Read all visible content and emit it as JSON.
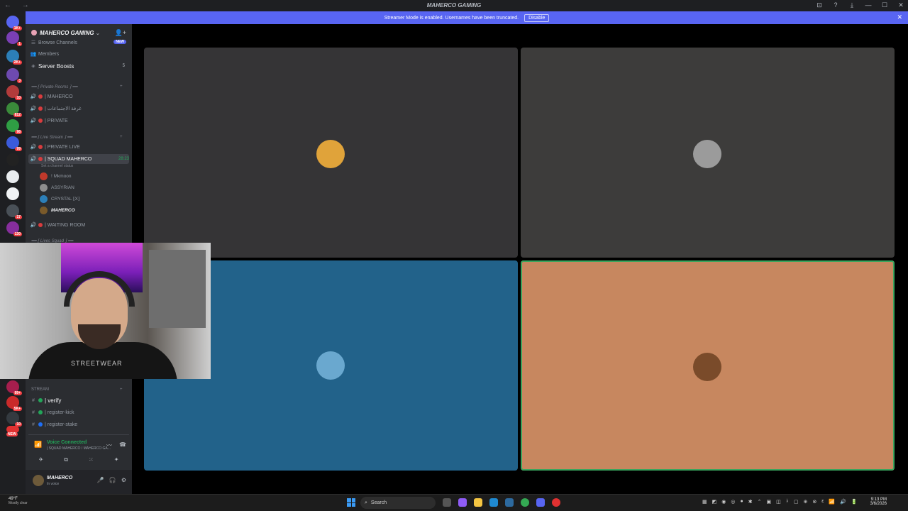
{
  "window": {
    "title": "MAHERCO GAMING",
    "nav": "← →",
    "controls": [
      "⊡",
      "?",
      "⤓",
      "—",
      "☐",
      "✕"
    ]
  },
  "banner": {
    "message": "Streamer Mode is enabled. Usernames have been truncated.",
    "button": "Disable",
    "close": "✕"
  },
  "guild_badges": [
    "1K+",
    "1",
    "2K+",
    "3",
    "10",
    "812",
    "98",
    "99",
    "",
    "",
    "17",
    "130"
  ],
  "guild_badges_lower": [
    "99+",
    "5K+",
    "10",
    "NEW"
  ],
  "sidebar": {
    "server_name": "MAHERCO GAMING",
    "chevron": "⌄",
    "invite_icon": "👤+",
    "browse_channels": "Browse Channels",
    "new_pill": "NEW",
    "members": "Members",
    "server_boosts": "Server Boosts",
    "boost_count": "5",
    "cat_private": "━━ ⁅ Private Rooms ⁆ ━━",
    "ch_maherco": "| MAHERCO",
    "ch_meeting": "| غرفة الاجتماعات",
    "ch_private": "| PRIVATE",
    "cat_live": "━━ ⁅ Live Stream ⁆ ━━",
    "ch_private_live": "| PRIVATE LIVE",
    "ch_squad": "| SQUAD MAHERCO",
    "squad_timer": "28:23",
    "squad_status": "Set a channel status",
    "members_list": [
      "! Mkmoon",
      "ASSYRIAN",
      "CRYSTAL ⁅X⁆",
      "MAHERCO"
    ],
    "ch_waiting": "| WAITING ROOM",
    "cat_lives": "━━ ⁅ Lives Squad ⁆ ━━",
    "cat_stream": "STREAM",
    "ch_verify": "| verify",
    "ch_register_kick": "| register-kick",
    "ch_register_stake": "| register-stake",
    "plus": "+"
  },
  "voice": {
    "title": "Voice Connected",
    "subtitle": "| SQUAD MAHERCO / MAHERCO GA...",
    "signal": "📶",
    "wave": "〰",
    "hangup": "☎"
  },
  "voice_buttons": [
    "✈",
    "⧉",
    "⁙",
    "✦"
  ],
  "user": {
    "name": "MAHERCO",
    "status": "In voice",
    "mic": "🎤",
    "headset": "🎧",
    "settings": "⚙"
  },
  "tiles": [
    {
      "name": "tile-1",
      "color": "#353436",
      "avatar": "#e0a33a"
    },
    {
      "name": "tile-2",
      "color": "#3d3c3b",
      "avatar": "#9b9b9b"
    },
    {
      "name": "tile-3",
      "color": "#22628a",
      "avatar": "#6aa8cf"
    },
    {
      "name": "tile-4",
      "color": "#c7875f",
      "avatar": "#7a4b2a"
    }
  ],
  "webcam_text": "STREETWEAR",
  "taskbar": {
    "weather_temp": "49°F",
    "weather_desc": "Mostly clear",
    "search": "Search",
    "time": "9:13 PM",
    "date": "3/6/2026"
  },
  "tray_icons": [
    "▦",
    "◩",
    "◉",
    "◎",
    "●",
    "✱",
    "⌃",
    "▣",
    "◫",
    "ᚼ",
    "▢",
    "⊕",
    "⊗",
    "ε",
    "📶",
    "🔊",
    "🔋"
  ]
}
